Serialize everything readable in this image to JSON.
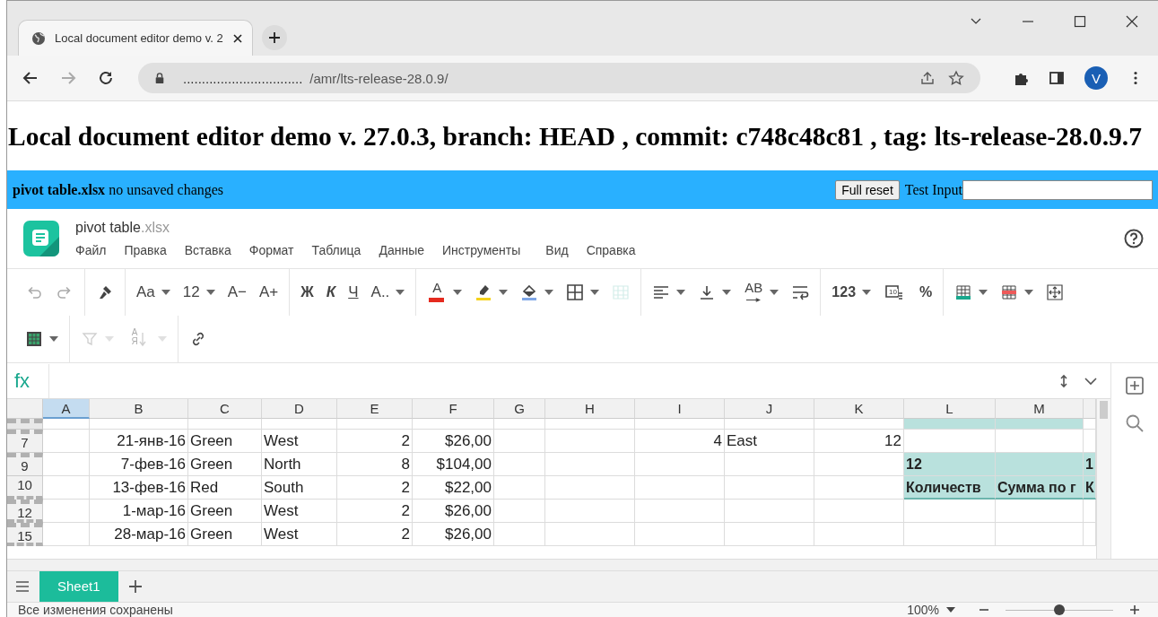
{
  "browser": {
    "tabs": [
      {
        "title": "Local document editor demo v. 2"
      }
    ],
    "url_host": "................................",
    "url_path": "/amr/lts-release-28.0.9/",
    "avatar": "V"
  },
  "page_title": "Local document editor demo v. 27.0.3, branch: HEAD , commit: c748c48c81 , tag: lts-release-28.0.9.7",
  "info_bar": {
    "text": "**pivot table.xlsx** no unsaved changes",
    "button": "Full reset",
    "input_label": "Test Input"
  },
  "editor": {
    "file_name": "pivot table",
    "file_ext": ".xlsx",
    "menu": [
      "Файл",
      "Правка",
      "Вставка",
      "Формат",
      "Таблица",
      "Данные",
      "Инструменты",
      "Вид",
      "Справка"
    ],
    "toolbar": [
      [
        [
          {
            "kind": "icon",
            "dropdown": false,
            "disabled": true
          },
          {
            "kind": "icon",
            "dropdown": false,
            "disabled": true
          }
        ],
        [
          {
            "kind": "icon",
            "dropdown": false,
            "disabled": false
          }
        ],
        [
          {
            "kind": "text",
            "label": "Aa",
            "dropdown": true,
            "disabled": false
          },
          {
            "kind": "text",
            "label": "12",
            "dropdown": true,
            "disabled": false
          },
          {
            "kind": "text",
            "label": "A−",
            "dropdown": false,
            "disabled": false
          },
          {
            "kind": "text",
            "label": "A+",
            "dropdown": false,
            "disabled": false
          }
        ],
        [
          {
            "kind": "text",
            "label": "Ж",
            "dropdown": false,
            "disabled": false
          },
          {
            "kind": "text",
            "label": "К",
            "dropdown": false,
            "disabled": false
          },
          {
            "kind": "text",
            "label": "Ч",
            "dropdown": false,
            "disabled": false
          },
          {
            "kind": "text",
            "label": "A..",
            "dropdown": true,
            "disabled": false
          }
        ],
        [
          {
            "kind": "icon-text",
            "label": "A",
            "dropdown": true,
            "disabled": false
          },
          {
            "kind": "icon",
            "dropdown": true,
            "disabled": false
          },
          {
            "kind": "icon",
            "dropdown": true,
            "disabled": false
          },
          {
            "kind": "icon",
            "dropdown": true,
            "disabled": false
          },
          {
            "kind": "icon",
            "dropdown": false,
            "disabled": true
          }
        ],
        [
          {
            "kind": "icon",
            "dropdown": true,
            "disabled": false
          },
          {
            "kind": "icon",
            "dropdown": true,
            "disabled": false
          },
          {
            "kind": "icon-text",
            "label": "AB",
            "dropdown": true,
            "disabled": false
          },
          {
            "kind": "icon",
            "dropdown": false,
            "disabled": false
          }
        ],
        [
          {
            "kind": "text",
            "label": "123",
            "dropdown": true,
            "disabled": false
          },
          {
            "kind": "icon-text",
            "label": "10",
            "dropdown": false,
            "disabled": false
          },
          {
            "kind": "text",
            "label": "%",
            "dropdown": false,
            "disabled": false
          }
        ],
        [
          {
            "kind": "icon",
            "dropdown": true,
            "disabled": false
          },
          {
            "kind": "icon",
            "dropdown": true,
            "disabled": false
          },
          {
            "kind": "icon",
            "dropdown": false,
            "disabled": false
          }
        ]
      ],
      [
        [
          {
            "kind": "icon",
            "dropdown": true,
            "disabled": false
          }
        ],
        [
          {
            "kind": "icon",
            "dropdown": true,
            "disabled": true
          },
          {
            "kind": "icon-text",
            "label": "A Я",
            "dropdown": true,
            "disabled": true
          }
        ],
        [
          {
            "kind": "icon",
            "dropdown": false,
            "disabled": false
          }
        ]
      ]
    ],
    "formula_label": "fx",
    "columns": [
      {
        "label": "A",
        "selected": true
      },
      {
        "label": "B",
        "selected": false
      },
      {
        "label": "C",
        "selected": false
      },
      {
        "label": "D",
        "selected": false
      },
      {
        "label": "E",
        "selected": false
      },
      {
        "label": "F",
        "selected": false
      },
      {
        "label": "G",
        "selected": false
      },
      {
        "label": "H",
        "selected": false
      },
      {
        "label": "I",
        "selected": false
      },
      {
        "label": "J",
        "selected": false
      },
      {
        "label": "K",
        "selected": false
      },
      {
        "label": "L",
        "selected": false
      },
      {
        "label": "M",
        "selected": false
      },
      {
        "selected": false
      }
    ],
    "rows": [
      {
        "partial": true,
        "hidden_above": true,
        "hidden_below": false,
        "cells": [
          {
            "kind": "blank"
          },
          {
            "kind": "blank"
          },
          {
            "kind": "blank"
          },
          {
            "kind": "blank"
          },
          {
            "kind": "blank"
          },
          {
            "kind": "blank"
          },
          {
            "kind": "blank"
          },
          {
            "kind": "blank"
          },
          {
            "kind": "blank"
          },
          {
            "kind": "blank"
          },
          {
            "kind": "blank"
          },
          {
            "kind": "pivot"
          },
          {
            "kind": "pivot"
          },
          {
            "kind": "blank"
          }
        ]
      },
      {
        "number": "7",
        "partial": false,
        "hidden_above": true,
        "hidden_below": false,
        "cells": [
          {
            "kind": "blank"
          },
          {
            "kind": "number",
            "text": "21-янв-16"
          },
          {
            "kind": "text",
            "text": "Green"
          },
          {
            "kind": "text",
            "text": "West"
          },
          {
            "kind": "number",
            "text": "2"
          },
          {
            "kind": "number",
            "text": "$26,00"
          },
          {
            "kind": "blank"
          },
          {
            "kind": "blank"
          },
          {
            "kind": "number",
            "text": "4"
          },
          {
            "kind": "text",
            "text": "East"
          },
          {
            "kind": "number",
            "text": "12"
          },
          {
            "kind": "blank"
          },
          {
            "kind": "blank"
          },
          {
            "kind": "blank"
          }
        ]
      },
      {
        "number": "9",
        "partial": false,
        "hidden_above": true,
        "hidden_below": false,
        "cells": [
          {
            "kind": "blank"
          },
          {
            "kind": "number",
            "text": "7-фев-16"
          },
          {
            "kind": "text",
            "text": "Green"
          },
          {
            "kind": "text",
            "text": "North"
          },
          {
            "kind": "number",
            "text": "8"
          },
          {
            "kind": "number",
            "text": "$104,00"
          },
          {
            "kind": "blank"
          },
          {
            "kind": "blank"
          },
          {
            "kind": "blank"
          },
          {
            "kind": "blank"
          },
          {
            "kind": "blank"
          },
          {
            "kind": "pivot",
            "text": "12"
          },
          {
            "kind": "pivot"
          },
          {
            "kind": "pivot",
            "text": "1"
          }
        ]
      },
      {
        "number": "10",
        "partial": false,
        "hidden_above": false,
        "hidden_below": true,
        "cells": [
          {
            "kind": "blank"
          },
          {
            "kind": "number",
            "text": "13-фев-16"
          },
          {
            "kind": "text",
            "text": "Red"
          },
          {
            "kind": "text",
            "text": "South"
          },
          {
            "kind": "number",
            "text": "2"
          },
          {
            "kind": "number",
            "text": "$22,00"
          },
          {
            "kind": "blank"
          },
          {
            "kind": "blank"
          },
          {
            "kind": "blank"
          },
          {
            "kind": "blank"
          },
          {
            "kind": "blank"
          },
          {
            "kind": "pivot-header",
            "text": "Количеств"
          },
          {
            "kind": "pivot-header",
            "text": "Сумма по г"
          },
          {
            "kind": "pivot-header",
            "text": "К"
          }
        ]
      },
      {
        "number": "12",
        "partial": false,
        "hidden_above": true,
        "hidden_below": true,
        "cells": [
          {
            "kind": "blank"
          },
          {
            "kind": "number",
            "text": "1-мар-16"
          },
          {
            "kind": "text",
            "text": "Green"
          },
          {
            "kind": "text",
            "text": "West"
          },
          {
            "kind": "number",
            "text": "2"
          },
          {
            "kind": "number",
            "text": "$26,00"
          },
          {
            "kind": "blank"
          },
          {
            "kind": "blank"
          },
          {
            "kind": "blank"
          },
          {
            "kind": "blank"
          },
          {
            "kind": "blank"
          },
          {
            "kind": "blank"
          },
          {
            "kind": "blank"
          },
          {
            "kind": "blank"
          }
        ]
      },
      {
        "number": "15",
        "partial": false,
        "hidden_above": true,
        "hidden_below": true,
        "cells": [
          {
            "kind": "blank"
          },
          {
            "kind": "number",
            "text": "28-мар-16"
          },
          {
            "kind": "text",
            "text": "Green"
          },
          {
            "kind": "text",
            "text": "West"
          },
          {
            "kind": "number",
            "text": "2"
          },
          {
            "kind": "number",
            "text": "$26,00"
          },
          {
            "kind": "blank"
          },
          {
            "kind": "blank"
          },
          {
            "kind": "blank"
          },
          {
            "kind": "blank"
          },
          {
            "kind": "blank"
          },
          {
            "kind": "blank"
          },
          {
            "kind": "blank"
          },
          {
            "kind": "blank"
          }
        ]
      }
    ],
    "sheets": [
      {
        "label": "Sheet1",
        "selected": true
      }
    ],
    "status": "Все изменения сохранены",
    "zoom": {
      "text": "100%",
      "level": 0.5
    }
  }
}
